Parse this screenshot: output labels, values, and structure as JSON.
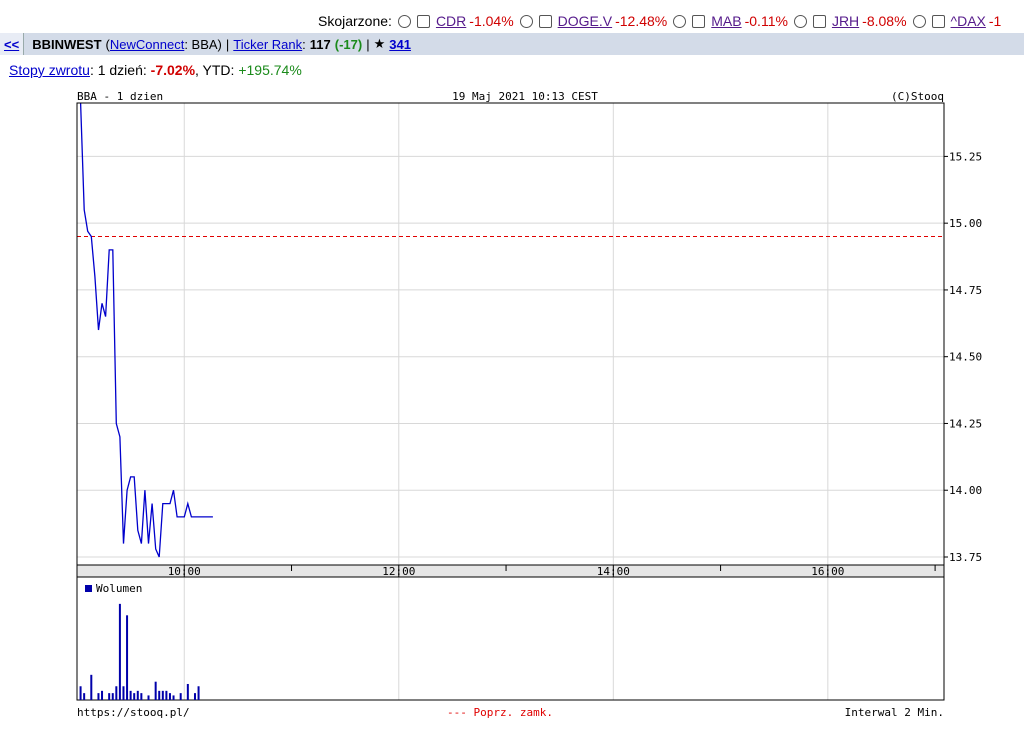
{
  "compare": {
    "label": "Skojarzone:",
    "items": [
      {
        "ticker": "CDR",
        "change": "-1.04%"
      },
      {
        "ticker": "DOGE.V",
        "change": "-12.48%"
      },
      {
        "ticker": "MAB",
        "change": "-0.11%"
      },
      {
        "ticker": "JRH",
        "change": "-8.08%"
      },
      {
        "ticker": "^DAX",
        "change": "-1"
      }
    ]
  },
  "info": {
    "back": "<<",
    "name": "BBINWEST",
    "paren_open": "(",
    "market": "NewConnect",
    "symbol_part": ": BBA)",
    "sep1": "|",
    "rank_label": "Ticker Rank",
    "rank_colon": ":",
    "rank": "117",
    "rank_change": "(-17)",
    "sep2": "|",
    "star": "★",
    "stars": "341"
  },
  "returns": {
    "label": "Stopy zwrotu",
    "day_label": ": 1 dzień:",
    "day_value": "-7.02%",
    "ytd_label": ", YTD:",
    "ytd_value": "+195.74%"
  },
  "colors": {
    "line": "#0000cc",
    "prev_close": "#e00000",
    "neg": "#d00000",
    "pos": "#1a8a1a"
  },
  "chart_data": {
    "type": "line",
    "header_left": "BBA - 1 dzien",
    "header_center": "19 Maj 2021 10:13 CEST",
    "header_right": "(C)Stooq",
    "x_ticks": [
      "10:00",
      "12:00",
      "14:00",
      "16:00"
    ],
    "y_ticks": [
      "13.75",
      "14.00",
      "14.25",
      "14.50",
      "14.75",
      "15.00",
      "15.25"
    ],
    "ylim": [
      13.72,
      15.45
    ],
    "xlim_hours": [
      9.0,
      17.083
    ],
    "prev_close": 14.95,
    "series": [
      {
        "x": [
          "9:02",
          "9:04",
          "9:06",
          "9:08",
          "9:10",
          "9:12",
          "9:14",
          "9:16",
          "9:18",
          "9:20",
          "9:22",
          "9:24",
          "9:26",
          "9:28",
          "9:30",
          "9:32",
          "9:34",
          "9:36",
          "9:38",
          "9:40",
          "9:42",
          "9:44",
          "9:46",
          "9:48",
          "9:50",
          "9:52",
          "9:54",
          "9:56",
          "9:58",
          "10:00",
          "10:02",
          "10:04",
          "10:06",
          "10:08",
          "10:10",
          "10:12",
          "10:14",
          "10:16"
        ],
        "values": [
          15.45,
          15.05,
          14.97,
          14.95,
          14.8,
          14.6,
          14.7,
          14.65,
          14.9,
          14.9,
          14.25,
          14.2,
          13.8,
          14.0,
          14.05,
          14.05,
          13.85,
          13.8,
          14.0,
          13.8,
          13.95,
          13.78,
          13.75,
          13.95,
          13.95,
          13.95,
          14.0,
          13.9,
          13.9,
          13.9,
          13.95,
          13.9,
          13.9,
          13.9,
          13.9,
          13.9,
          13.9,
          13.9
        ]
      }
    ],
    "volume": {
      "label": "Wolumen",
      "x": [
        "9:02",
        "9:04",
        "9:08",
        "9:12",
        "9:14",
        "9:18",
        "9:20",
        "9:22",
        "9:24",
        "9:26",
        "9:28",
        "9:30",
        "9:32",
        "9:34",
        "9:36",
        "9:40",
        "9:44",
        "9:46",
        "9:48",
        "9:50",
        "9:52",
        "9:54",
        "9:58",
        "10:02",
        "10:06",
        "10:08"
      ],
      "values": [
        6,
        3,
        11,
        3,
        4,
        3,
        3,
        6,
        42,
        6,
        37,
        4,
        3,
        4,
        3,
        2,
        8,
        4,
        4,
        4,
        3,
        2,
        3,
        7,
        3,
        6
      ]
    },
    "footer_left": "https://stooq.pl/",
    "footer_center": "--- Poprz. zamk.",
    "footer_right": "Interwal 2 Min."
  }
}
